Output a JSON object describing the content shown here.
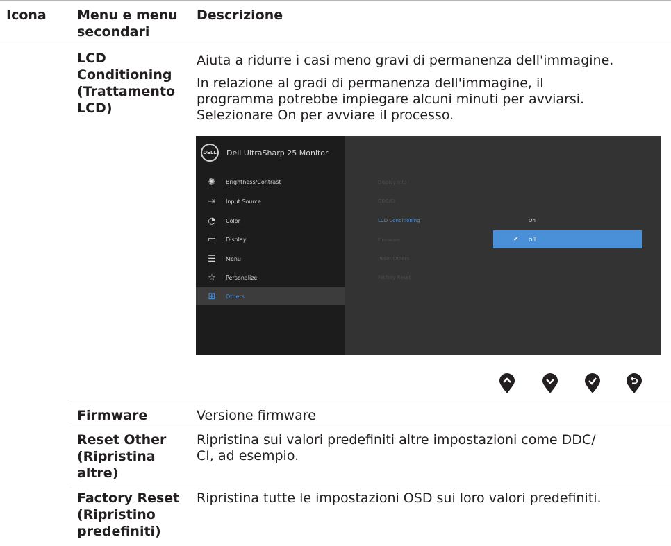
{
  "header": {
    "col_icon": "Icona",
    "col_menu": "Menu e menu secondari",
    "col_desc": "Descrizione"
  },
  "rows": {
    "lcd": {
      "term_lines": [
        "LCD",
        "Conditioning",
        "(Trattamento",
        "LCD)"
      ],
      "desc_line1": "Aiuta a ridurre i casi meno gravi di permanenza dell'immagine.",
      "desc_para2_lines": [
        "In relazione al gradi di permanenza dell'immagine, il",
        "programma potrebbe impiegare alcuni minuti per avviarsi.",
        "Selezionare On per avviare il processo."
      ]
    },
    "firmware": {
      "term": "Firmware",
      "desc": "Versione firmware"
    },
    "reset_other": {
      "term_lines": [
        "Reset Other",
        "(Ripristina",
        "altre)"
      ],
      "desc_lines": [
        "Ripristina sui valori predefiniti altre impostazioni come DDC/",
        "CI, ad esempio."
      ]
    },
    "factory_reset": {
      "term_lines": [
        "Factory Reset",
        "(Ripristino",
        "predefiniti)"
      ],
      "desc": "Ripristina tutte le impostazioni OSD sui loro valori predefiniti."
    }
  },
  "osd": {
    "logo_text": "DELL",
    "title": "Dell UltraSharp 25 Monitor",
    "menu": [
      {
        "label": "Brightness/Contrast",
        "icon": "brightness-icon"
      },
      {
        "label": "Input Source",
        "icon": "input-source-icon"
      },
      {
        "label": "Color",
        "icon": "color-palette-icon"
      },
      {
        "label": "Display",
        "icon": "display-icon"
      },
      {
        "label": "Menu",
        "icon": "menu-icon"
      },
      {
        "label": "Personalize",
        "icon": "star-icon"
      },
      {
        "label": "Others",
        "icon": "others-icon"
      }
    ],
    "submenu": [
      "Display Info",
      "DDC/CI",
      "LCD Conditioning",
      "Firmware",
      "Reset Others",
      "Factory Reset"
    ],
    "options": {
      "on": "On",
      "off": "Off"
    },
    "colors": {
      "accent": "#4a90d9",
      "panel_left": "#1c1c1c",
      "panel_right": "#333333"
    }
  },
  "nav_buttons": [
    "up-icon",
    "down-icon",
    "check-icon",
    "back-icon"
  ]
}
